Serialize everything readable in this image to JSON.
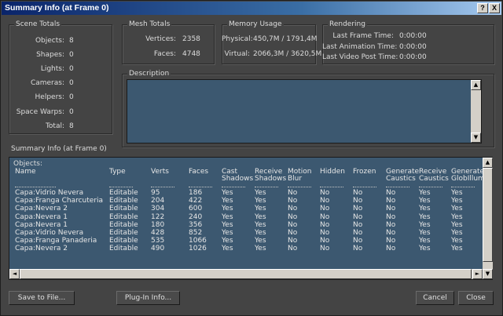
{
  "title": "Summary Info (at Frame 0)",
  "title_buttons": {
    "help": "?",
    "close": "X"
  },
  "scene_totals": {
    "title": "Scene Totals",
    "rows": [
      {
        "label": "Objects:",
        "value": "8"
      },
      {
        "label": "Shapes:",
        "value": "0"
      },
      {
        "label": "Lights:",
        "value": "0"
      },
      {
        "label": "Cameras:",
        "value": "0"
      },
      {
        "label": "Helpers:",
        "value": "0"
      },
      {
        "label": "Space Warps:",
        "value": "0"
      },
      {
        "label": "Total:",
        "value": "8"
      }
    ]
  },
  "mesh_totals": {
    "title": "Mesh Totals",
    "vertices_label": "Vertices:",
    "vertices": "2358",
    "faces_label": "Faces:",
    "faces": "4748"
  },
  "memory_usage": {
    "title": "Memory Usage",
    "physical_label": "Physical:",
    "physical": "450,7M / 1791,4M",
    "virtual_label": "Virtual:",
    "virtual": "2066,3M / 3620,5M"
  },
  "rendering": {
    "title": "Rendering",
    "rows": [
      {
        "label": "Last Frame Time:",
        "value": "0:00:00"
      },
      {
        "label": "Last Animation Time:",
        "value": "0:00:00"
      },
      {
        "label": "Last Video Post Time:",
        "value": "0:00:00"
      }
    ]
  },
  "description": {
    "title": "Description",
    "text": ""
  },
  "summary_label": "Summary Info (at Frame 0)",
  "objects_label": "Objects:",
  "table": {
    "columns": [
      [
        "",
        "Name"
      ],
      [
        "",
        "Type"
      ],
      [
        "",
        "Verts"
      ],
      [
        "",
        "Faces"
      ],
      [
        "Cast",
        "Shadows"
      ],
      [
        "Receive",
        "Shadows"
      ],
      [
        "Motion",
        "Blur"
      ],
      [
        "",
        "Hidden"
      ],
      [
        "",
        "Frozen"
      ],
      [
        "Generate",
        "Caustics"
      ],
      [
        "Receive",
        "Caustics"
      ],
      [
        "Generate",
        "GlobIllum"
      ]
    ],
    "rows": [
      [
        "Capa:Vidrio Nevera",
        "Editable",
        "95",
        "186",
        "Yes",
        "Yes",
        "No",
        "No",
        "No",
        "No",
        "Yes",
        "Yes"
      ],
      [
        "Capa:Franga Charcuteria",
        "Editable",
        "204",
        "422",
        "Yes",
        "Yes",
        "No",
        "No",
        "No",
        "No",
        "Yes",
        "Yes"
      ],
      [
        "Capa:Nevera 2",
        "Editable",
        "304",
        "600",
        "Yes",
        "Yes",
        "No",
        "No",
        "No",
        "No",
        "Yes",
        "Yes"
      ],
      [
        "Capa:Nevera 1",
        "Editable",
        "122",
        "240",
        "Yes",
        "Yes",
        "No",
        "No",
        "No",
        "No",
        "Yes",
        "Yes"
      ],
      [
        "Capa:Nevera 1",
        "Editable",
        "180",
        "356",
        "Yes",
        "Yes",
        "No",
        "No",
        "No",
        "No",
        "Yes",
        "Yes"
      ],
      [
        "Capa:Vidrio Nevera",
        "Editable",
        "428",
        "852",
        "Yes",
        "Yes",
        "No",
        "No",
        "No",
        "No",
        "Yes",
        "Yes"
      ],
      [
        "Capa:Franga Panaderia",
        "Editable",
        "535",
        "1066",
        "Yes",
        "Yes",
        "No",
        "No",
        "No",
        "No",
        "Yes",
        "Yes"
      ],
      [
        "Capa:Nevera 2",
        "Editable",
        "490",
        "1026",
        "Yes",
        "Yes",
        "No",
        "No",
        "No",
        "No",
        "Yes",
        "Yes"
      ]
    ]
  },
  "buttons": {
    "save": "Save to File...",
    "plugin": "Plug-In Info...",
    "cancel": "Cancel",
    "close": "Close"
  },
  "scroll_glyphs": {
    "up": "▲",
    "down": "▼",
    "left": "◄",
    "right": "►"
  },
  "colors": {
    "panel": "#444444",
    "list_bg": "#3c5870",
    "title_bar": "#0a246a"
  }
}
